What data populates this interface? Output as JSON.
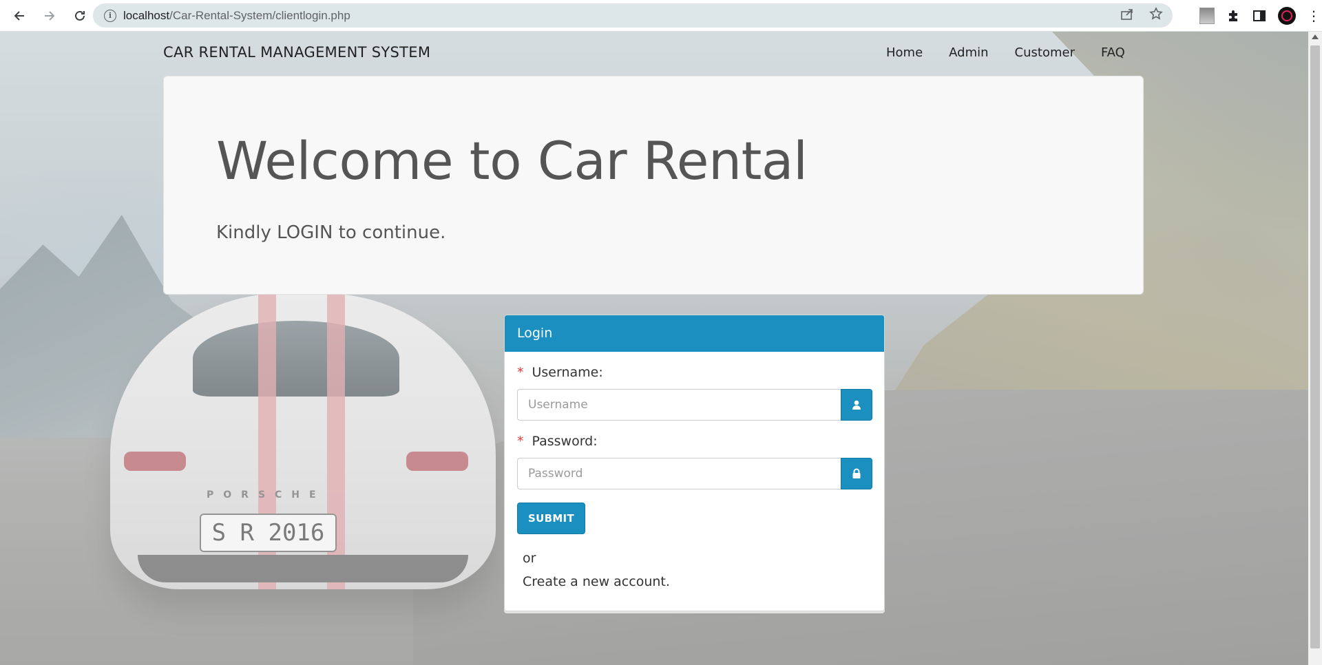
{
  "browser": {
    "url_host": "localhost",
    "url_path": "/Car-Rental-System/clientlogin.php",
    "icons": [
      "back-arrow-icon",
      "forward-arrow-icon",
      "reload-icon",
      "site-info-icon",
      "share-icon",
      "bookmark-star-icon",
      "extension-puzzle-icon",
      "side-panel-icon",
      "profile-avatar-icon",
      "more-menu-icon"
    ]
  },
  "site": {
    "brand": "CAR RENTAL MANAGEMENT SYSTEM",
    "nav": [
      "Home",
      "Admin",
      "Customer",
      "FAQ"
    ]
  },
  "jumbotron": {
    "title": "Welcome to Car Rental",
    "subtitle": "Kindly LOGIN to continue."
  },
  "login": {
    "heading": "Login",
    "username_label": "Username:",
    "username_placeholder": "Username",
    "password_label": "Password:",
    "password_placeholder": "Password",
    "required_mark": "*",
    "submit_label": "SUBMIT",
    "or_text": "or",
    "create_account_text": "Create a new account."
  },
  "background": {
    "plate_text": "S R 2016",
    "car_brand_text": "PORSCHE"
  },
  "colors": {
    "primary": "#1a8fc0",
    "required": "#e23b3b",
    "jumbotron_bg": "#f8f8f8"
  }
}
